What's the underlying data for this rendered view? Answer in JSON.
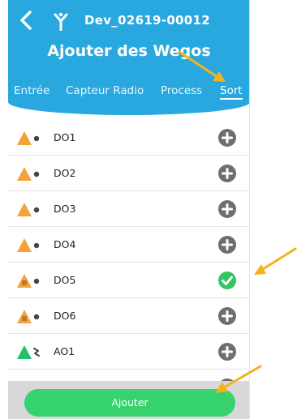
{
  "header": {
    "device_id": "Dev_02619-00012",
    "title": "Ajouter des Wegos",
    "tabs": [
      {
        "label": "Entrée",
        "active": false
      },
      {
        "label": "Capteur Radio",
        "active": false
      },
      {
        "label": "Process",
        "active": false
      },
      {
        "label": "Sort",
        "active": true
      }
    ]
  },
  "list": {
    "items": [
      {
        "label": "DO1",
        "icon": "orange-triangle-dot-icon",
        "selected": false
      },
      {
        "label": "DO2",
        "icon": "orange-triangle-dot-icon",
        "selected": false
      },
      {
        "label": "DO3",
        "icon": "orange-triangle-dot-icon",
        "selected": false
      },
      {
        "label": "DO4",
        "icon": "orange-triangle-dot-icon",
        "selected": false
      },
      {
        "label": "DO5",
        "icon": "orange-triangle-warning-icon",
        "selected": true
      },
      {
        "label": "DO6",
        "icon": "orange-triangle-warning-icon",
        "selected": false
      },
      {
        "label": "AO1",
        "icon": "green-triangle-signal-icon",
        "selected": false
      }
    ]
  },
  "footer": {
    "add_label": "Ajouter"
  },
  "colors": {
    "header_blue": "#28a8df",
    "add_green": "#35d26d",
    "check_green": "#35c463",
    "plus_gray": "#6e6e6e",
    "annotation_arrow": "#f3b21c"
  }
}
